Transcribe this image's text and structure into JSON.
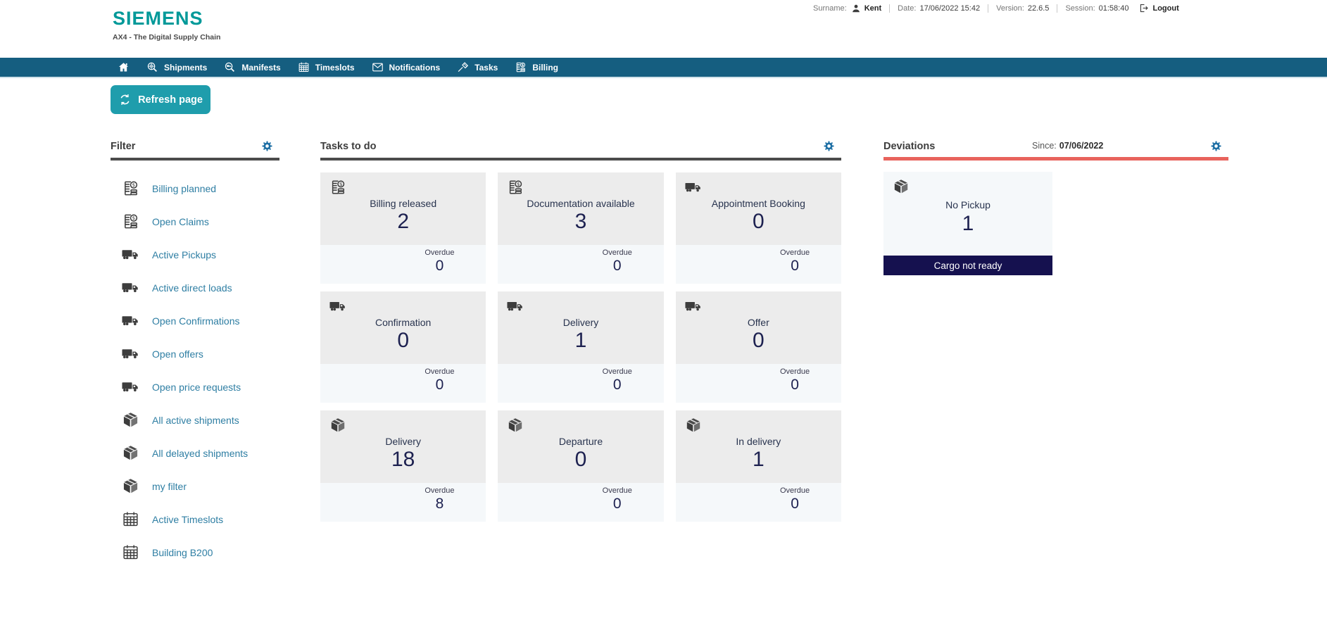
{
  "brand": {
    "name": "SIEMENS",
    "tagline": "AX4 - The Digital Supply Chain"
  },
  "session_bar": {
    "surname_label": "Surname:",
    "surname_icon": "user-icon",
    "surname_value": "Kent",
    "date_label": "Date:",
    "date_value": "17/06/2022 15:42",
    "version_label": "Version:",
    "version_value": "22.6.5",
    "session_label": "Session:",
    "session_value": "01:58:40",
    "logout_icon": "logout-icon",
    "logout_label": "Logout"
  },
  "navbar": {
    "items": [
      {
        "icon": "home-icon",
        "label": ""
      },
      {
        "icon": "search-globe-icon",
        "label": "Shipments"
      },
      {
        "icon": "search-truck-icon",
        "label": "Manifests"
      },
      {
        "icon": "calendar-icon",
        "label": "Timeslots"
      },
      {
        "icon": "envelope-icon",
        "label": "Notifications"
      },
      {
        "icon": "hammer-icon",
        "label": "Tasks"
      },
      {
        "icon": "billing-icon",
        "label": "Billing"
      }
    ]
  },
  "toolbar": {
    "refresh_label": "Refresh page",
    "refresh_icon": "refresh-icon"
  },
  "filter": {
    "title": "Filter",
    "gear_icon": "gear-icon",
    "items": [
      {
        "icon": "billing-icon",
        "label": "Billing planned"
      },
      {
        "icon": "billing-icon",
        "label": "Open Claims"
      },
      {
        "icon": "truck-icon",
        "label": "Active Pickups"
      },
      {
        "icon": "truck-icon",
        "label": "Active direct loads"
      },
      {
        "icon": "truck-icon",
        "label": "Open Confirmations"
      },
      {
        "icon": "truck-icon",
        "label": "Open offers"
      },
      {
        "icon": "truck-icon",
        "label": "Open price requests"
      },
      {
        "icon": "cube-icon",
        "label": "All active shipments"
      },
      {
        "icon": "cube-icon",
        "label": "All delayed shipments"
      },
      {
        "icon": "cube-icon",
        "label": "my filter"
      },
      {
        "icon": "calendar-icon",
        "label": "Active Timeslots"
      },
      {
        "icon": "calendar-icon",
        "label": "Building B200"
      }
    ]
  },
  "tasks": {
    "title": "Tasks to do",
    "gear_icon": "gear-icon",
    "overdue_label": "Overdue",
    "cards": [
      {
        "icon": "billing-icon",
        "title": "Billing released",
        "count": "2",
        "overdue": "0"
      },
      {
        "icon": "billing-icon",
        "title": "Documentation available",
        "count": "3",
        "overdue": "0"
      },
      {
        "icon": "truck-icon",
        "title": "Appointment Booking",
        "count": "0",
        "overdue": "0"
      },
      {
        "icon": "truck-icon",
        "title": "Confirmation",
        "count": "0",
        "overdue": "0"
      },
      {
        "icon": "truck-icon",
        "title": "Delivery",
        "count": "1",
        "overdue": "0"
      },
      {
        "icon": "truck-icon",
        "title": "Offer",
        "count": "0",
        "overdue": "0"
      },
      {
        "icon": "cube-icon",
        "title": "Delivery",
        "count": "18",
        "overdue": "8"
      },
      {
        "icon": "cube-icon",
        "title": "Departure",
        "count": "0",
        "overdue": "0"
      },
      {
        "icon": "cube-icon",
        "title": "In delivery",
        "count": "1",
        "overdue": "0"
      }
    ]
  },
  "deviations": {
    "title": "Deviations",
    "gear_icon": "gear-icon",
    "since_label": "Since:",
    "since_value": "07/06/2022",
    "cards": [
      {
        "icon": "cube-icon",
        "title": "No Pickup",
        "count": "1",
        "badge": "Cargo not ready"
      }
    ]
  },
  "colors": {
    "brand_teal": "#009999",
    "navbar_blue": "#155e80",
    "link_blue": "#2e7ea3",
    "refresh_teal": "#1f9dac",
    "rule_dark": "#4b4b4b",
    "deviation_accent": "#e8635c",
    "count_navy": "#1d2150",
    "badge_navy": "#15114f",
    "card_gray": "#ececec",
    "card_light": "#f5f8fa",
    "gear_blue": "#1c6ea4"
  }
}
